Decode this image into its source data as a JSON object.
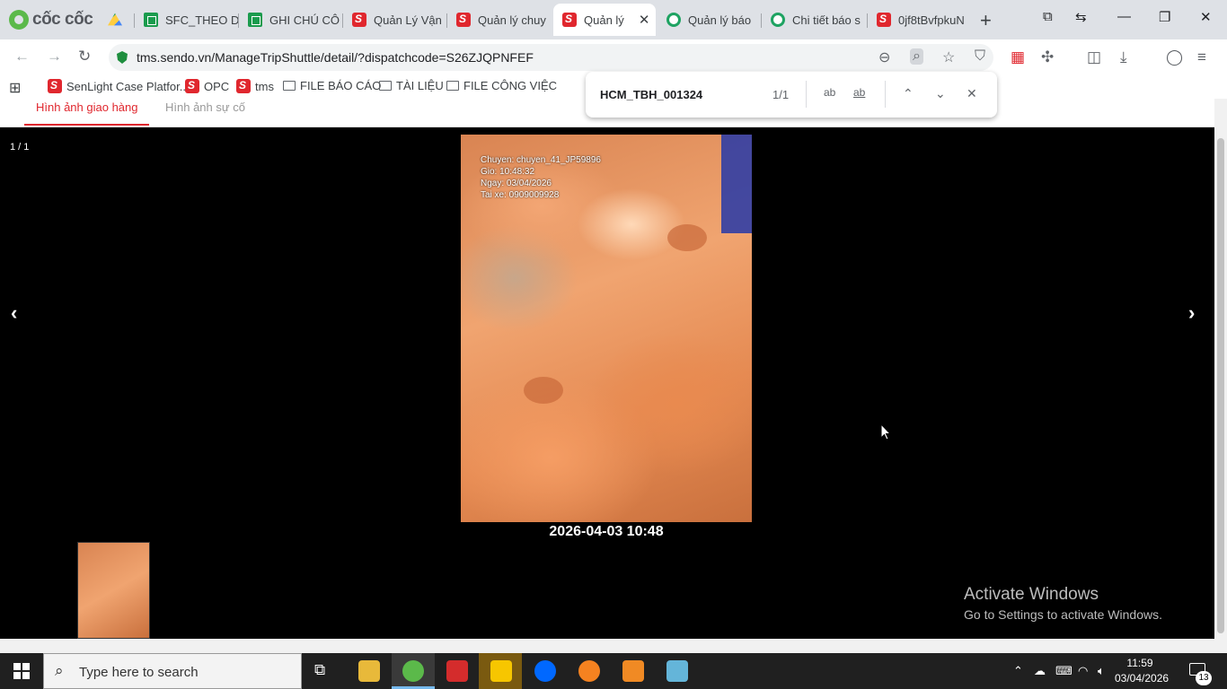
{
  "browser": {
    "brand": "cốc cốc",
    "tabs": [
      {
        "title": "",
        "icon": "google-drive-icon"
      },
      {
        "title": "SFC_THEO D",
        "icon": "sheets-icon"
      },
      {
        "title": "GHI CHÚ CÔ",
        "icon": "sheets-icon"
      },
      {
        "title": "Quản Lý Vận",
        "icon": "sendo-icon"
      },
      {
        "title": "Quản lý chuy",
        "icon": "sendo-icon"
      },
      {
        "title": "Quản lý",
        "icon": "sendo-icon",
        "active": true
      },
      {
        "title": "Quản lý báo",
        "icon": "green-s-icon"
      },
      {
        "title": "Chi tiết báo s",
        "icon": "green-s-icon"
      },
      {
        "title": "0jf8tBvfpkuN",
        "icon": "sendo-icon"
      }
    ],
    "url": "tms.sendo.vn/ManageTripShuttle/detail/?dispatchcode=S26ZJQPNFEF",
    "bookmarks": [
      {
        "label": "SenLight Case Platfor...",
        "icon": "sendo-icon"
      },
      {
        "label": "OPC",
        "icon": "sendo-icon"
      },
      {
        "label": "tms",
        "icon": "sendo-icon"
      },
      {
        "label": "FILE BÁO CÁO",
        "icon": "folder-icon"
      },
      {
        "label": "TÀI LIỆU",
        "icon": "folder-icon"
      },
      {
        "label": "FILE CÔNG VIỆC",
        "icon": "folder-icon"
      }
    ],
    "find": {
      "query": "HCM_TBH_001324",
      "count": "1/1",
      "match_case_label": "ab",
      "whole_word_label": "ab"
    }
  },
  "page": {
    "tabs": [
      "Hình ảnh giao hàng",
      "Hình ảnh sự cố"
    ],
    "counter": "1 / 1",
    "prev": "‹",
    "next": "›",
    "photo_stamp": [
      "Chuyen: chuyen_41_JP59896",
      "Gio: 10:48:32",
      "Ngay: 03/04/2026",
      "Tai xe: 0909009928"
    ],
    "caption": "2026-04-03 10:48",
    "watermark_title": "Activate Windows",
    "watermark_sub": "Go to Settings to activate Windows."
  },
  "taskbar": {
    "search_placeholder": "Type here to search",
    "time": "11:59",
    "date": "03/04/2026",
    "notifications": "13"
  },
  "colors": {
    "accent": "#e0272e",
    "page_bg": "#000000",
    "taskbar_bg": "#202020"
  }
}
